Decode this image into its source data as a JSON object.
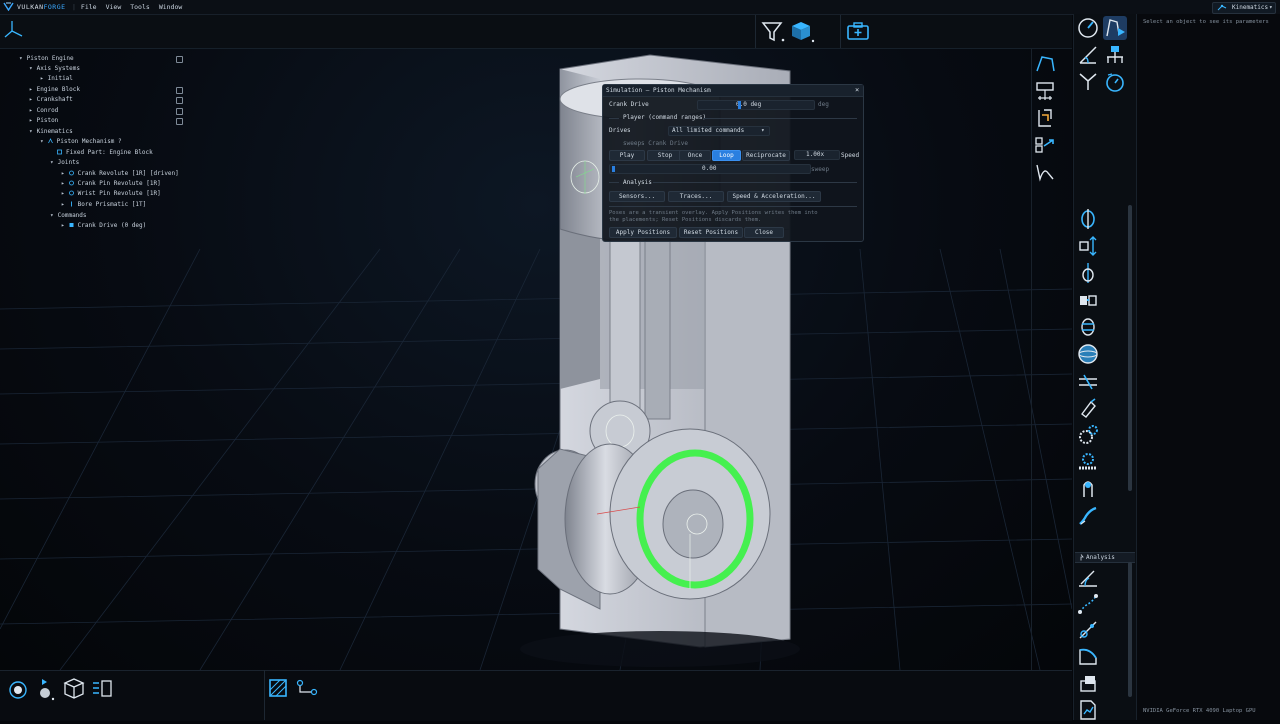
{
  "app": {
    "brand": "VULKAN",
    "brand_accent": "FORGE",
    "menus": [
      "File",
      "View",
      "Tools",
      "Window"
    ],
    "mode": "Kinematics"
  },
  "tree": {
    "items": [
      {
        "label": "Piston Engine"
      },
      {
        "label": "Axis Systems"
      },
      {
        "label": "Initial"
      },
      {
        "label": "Engine Block"
      },
      {
        "label": "Crankshaft"
      },
      {
        "label": "Conrod"
      },
      {
        "label": "Piston"
      },
      {
        "label": "Kinematics"
      },
      {
        "label": "Piston Mechanism  ?"
      },
      {
        "label": "Fixed Part:  Engine Block"
      },
      {
        "label": "Joints"
      },
      {
        "label": "Crank Revolute  [1R]  [driven]"
      },
      {
        "label": "Crank Pin Revolute  [1R]"
      },
      {
        "label": "Wrist Pin Revolute  [1R]"
      },
      {
        "label": "Bore Prismatic  [1T]"
      },
      {
        "label": "Commands"
      },
      {
        "label": "Crank Drive  (0 deg)"
      }
    ]
  },
  "dialog": {
    "title": "Simulation — Piston Mechanism",
    "close": "×",
    "crank_label": "Crank Drive",
    "crank_value": "0.0 deg",
    "crank_unit": "deg",
    "player_section": "Player (command ranges)",
    "drives_label": "Drives",
    "drives_value": "All limited commands",
    "sweeps_text": "sweeps Crank Drive",
    "buttons": {
      "play": "Play",
      "stop": "Stop",
      "once": "Once",
      "loop": "Loop",
      "reciprocate": "Reciprocate"
    },
    "speed_value": "1.00x",
    "speed_label": "Speed",
    "sweep_value": "0.00",
    "sweep_label": "sweep",
    "analysis_section": "Analysis",
    "analysis_buttons": {
      "sensors": "Sensors...",
      "traces": "Traces...",
      "speed_accel": "Speed & Acceleration..."
    },
    "note_line1": "Poses are a transient overlay. Apply Positions writes them into",
    "note_line2": "the placements; Reset Positions discards them.",
    "footer": {
      "apply": "Apply Positions",
      "reset": "Reset Positions",
      "close": "Close"
    }
  },
  "right_panel": {
    "analysis_header": "Analysis",
    "hint": "Select an object to see its parameters",
    "gpu": "NVIDIA GeForce RTX 4090 Laptop GPU"
  },
  "colors": {
    "accent": "#2a7fe0",
    "icon_cyan": "#39b6ff",
    "highlight_green": "#3ee04a",
    "panel_bg": "#0a0e13"
  }
}
